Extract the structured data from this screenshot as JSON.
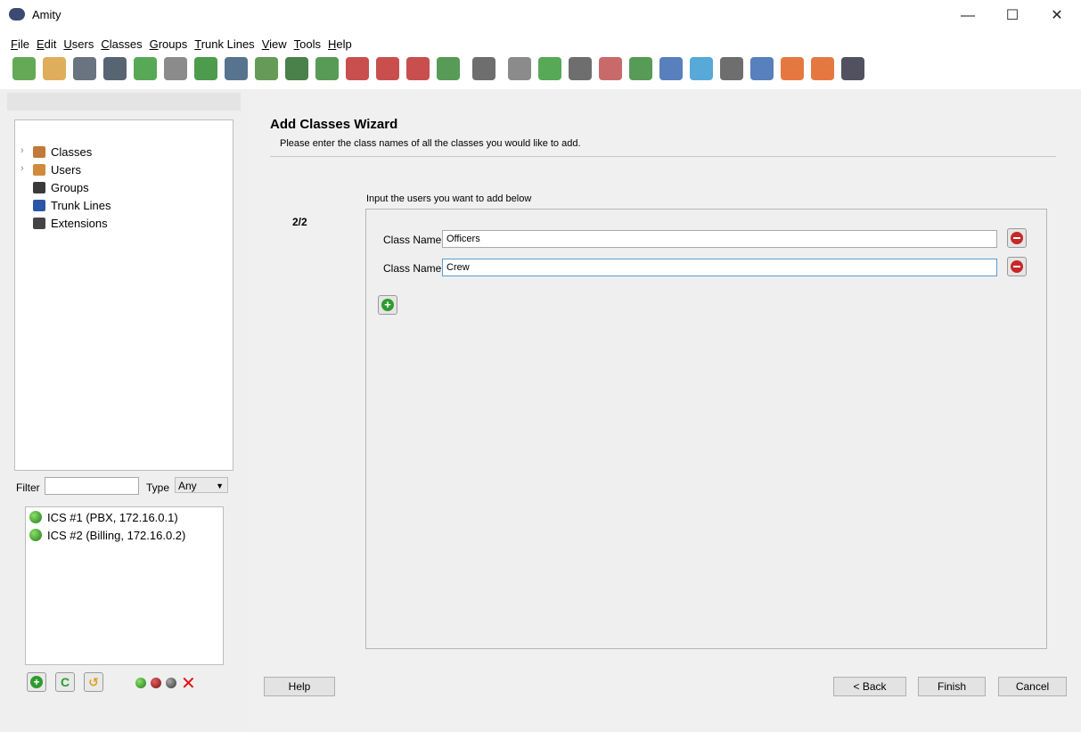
{
  "window": {
    "title": "Amity",
    "controls": {
      "minimize": "—",
      "maximize": "☐",
      "close": "✕"
    }
  },
  "menubar": [
    {
      "label": "File",
      "u": "F",
      "rest": "ile"
    },
    {
      "label": "Edit",
      "u": "E",
      "rest": "dit"
    },
    {
      "label": "Users",
      "u": "U",
      "rest": "sers"
    },
    {
      "label": "Classes",
      "u": "C",
      "rest": "lasses"
    },
    {
      "label": "Groups",
      "u": "G",
      "rest": "roups"
    },
    {
      "label": "Trunk Lines",
      "u": "T",
      "rest": "runk Lines"
    },
    {
      "label": "View",
      "u": "V",
      "rest": "iew"
    },
    {
      "label": "Tools",
      "u": "T",
      "rest": "ools"
    },
    {
      "label": "Help",
      "u": "H",
      "rest": "elp"
    }
  ],
  "tree": [
    {
      "label": "Classes",
      "expandable": true,
      "icon": "classes-icon",
      "color": "#c17a3a"
    },
    {
      "label": "Users",
      "expandable": true,
      "icon": "user-icon",
      "color": "#d08a3c"
    },
    {
      "label": "Groups",
      "expandable": false,
      "icon": "groups-icon",
      "color": "#3a3a3a"
    },
    {
      "label": "Trunk Lines",
      "expandable": false,
      "icon": "trunk-lines-icon",
      "color": "#2b56a8"
    },
    {
      "label": "Extensions",
      "expandable": false,
      "icon": "extensions-icon",
      "color": "#444"
    }
  ],
  "filter": {
    "label": "Filter",
    "value": "",
    "type_label": "Type",
    "type_value": "Any"
  },
  "servers": [
    {
      "label": "ICS #1 (PBX, 172.16.0.1)",
      "status": "online"
    },
    {
      "label": "ICS #2 (Billing, 172.16.0.2)",
      "status": "online"
    }
  ],
  "bottom_left": {
    "add": "+",
    "refresh": "C",
    "undo": "↺",
    "remove": "✕"
  },
  "wizard": {
    "title": "Add Classes Wizard",
    "subtitle": "Please enter the class names of all the classes you would like to add.",
    "step": "2/2",
    "hint": "Input the users you want to add below",
    "fields": [
      {
        "label": "Class Name",
        "value": "Officers"
      },
      {
        "label": "Class Name",
        "value": "Crew"
      }
    ],
    "buttons": {
      "help": "Help",
      "back": "< Back",
      "finish": "Finish",
      "cancel": "Cancel"
    }
  },
  "colors": {
    "panel": "#efefef",
    "accent_green": "#2e9b2e",
    "remove_red": "#c62828"
  }
}
